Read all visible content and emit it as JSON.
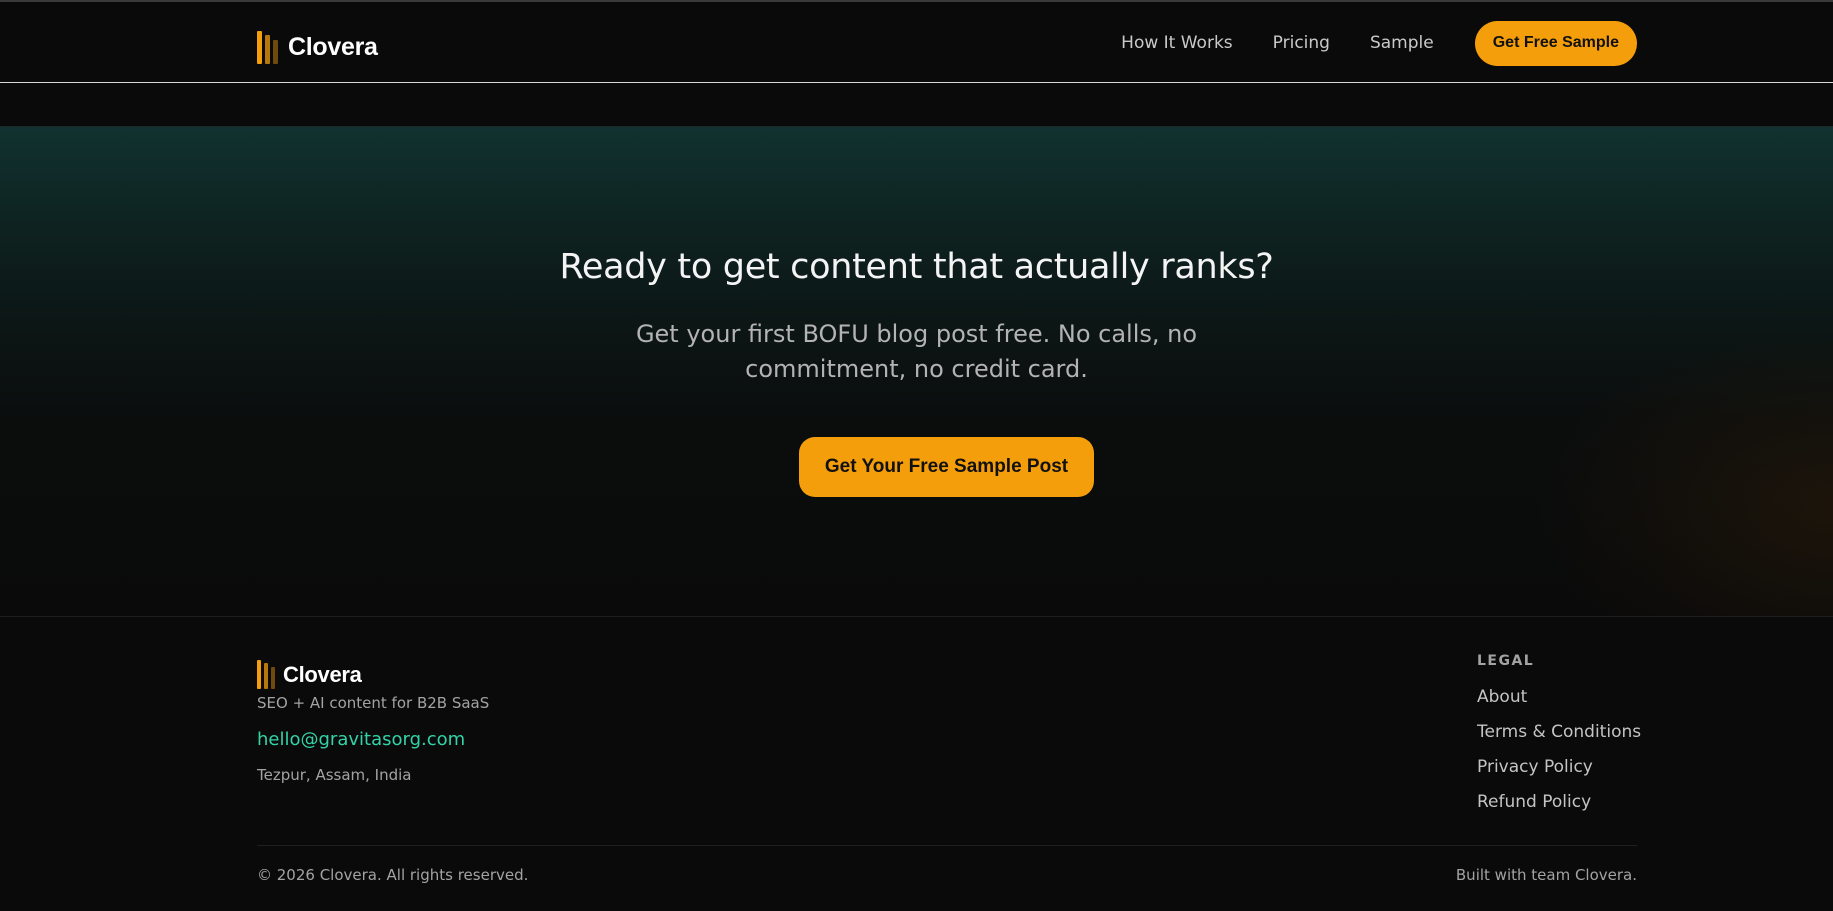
{
  "header": {
    "brand": "Clovera",
    "nav": [
      {
        "label": "How It Works"
      },
      {
        "label": "Pricing"
      },
      {
        "label": "Sample"
      }
    ],
    "cta_label": "Get Free Sample"
  },
  "hero": {
    "title": "Ready to get content that actually ranks?",
    "subtitle": "Get your first BOFU blog post free. No calls, no commitment, no credit card.",
    "button_label": "Get Your Free Sample Post"
  },
  "footer": {
    "brand": "Clovera",
    "tagline": "SEO + AI content for B2B SaaS",
    "email": "hello@gravitasorg.com",
    "location": "Tezpur, Assam, India",
    "legal_heading": "LEGAL",
    "legal_links": [
      {
        "label": "About"
      },
      {
        "label": "Terms & Conditions"
      },
      {
        "label": "Privacy Policy"
      },
      {
        "label": "Refund Policy"
      }
    ],
    "copyright": "© 2026 Clovera. All rights reserved.",
    "built_with": "Built with team Clovera."
  },
  "colors": {
    "accent": "#f59e0b",
    "email_link": "#34d3a6",
    "background": "#0a0a0a",
    "hero_glow": "#113230"
  },
  "icons": {
    "brand_logo": "bar-chart-logo-icon"
  }
}
